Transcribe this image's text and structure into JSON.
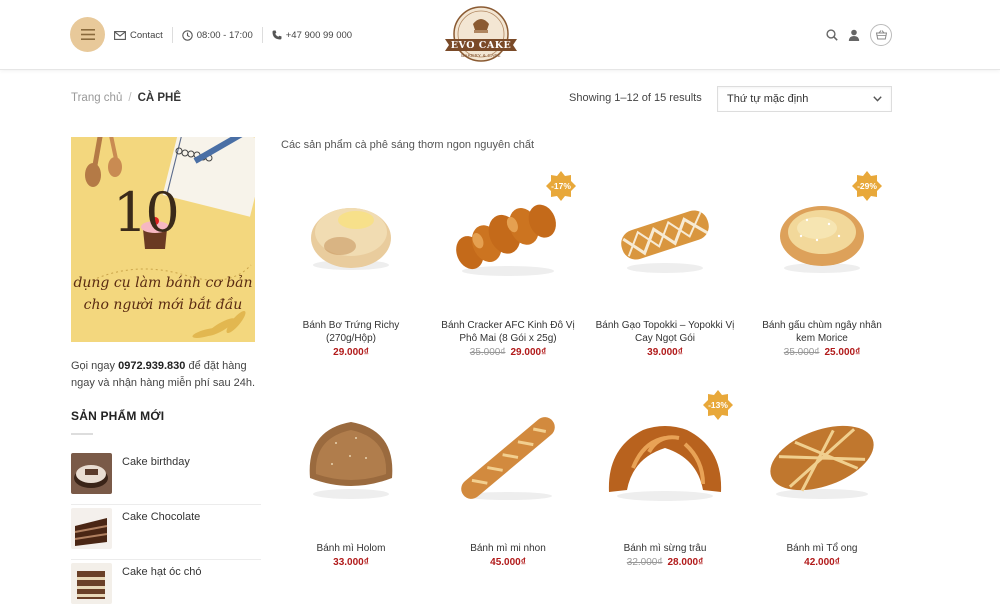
{
  "header": {
    "contact_label": "Contact",
    "hours": "08:00 - 17:00",
    "phone": "+47 900 99 000",
    "logo_text": "EVO CAKE",
    "logo_tagline": "BAKERY & CAFE"
  },
  "breadcrumb": {
    "home": "Trang chủ",
    "separator": "/",
    "current": "CÀ PHÊ"
  },
  "results_text": "Showing 1–12 of 15 results",
  "sort": {
    "selected": "Thứ tự mặc định"
  },
  "promo": {
    "number": "10",
    "line1": "dụng cụ làm bánh cơ bản",
    "line2": "cho người mới bắt đầu"
  },
  "sidebar": {
    "call_prefix": "Gọi ngay ",
    "call_phone": "0972.939.830",
    "call_suffix": " để đặt hàng ngay và nhận hàng miễn phí sau 24h.",
    "heading": "SẢN PHẨM MỚI",
    "items": [
      {
        "name": "Cake birthday"
      },
      {
        "name": "Cake Chocolate"
      },
      {
        "name": "Cake hạt óc chó"
      }
    ]
  },
  "intro": "Các sản phẩm cà phê sáng thơm ngon nguyên chất",
  "products": [
    {
      "title": "Bánh Bơ Trứng Richy (270g/Hộp)",
      "old_price": "",
      "price": "29.000₫",
      "badge": ""
    },
    {
      "title": "Bánh Cracker AFC Kinh Đô Vị Phô Mai (8 Gói x 25g)",
      "old_price": "35.000₫",
      "price": "29.000₫",
      "badge": "-17%"
    },
    {
      "title": "Bánh Gạo Topokki – Yopokki Vị Cay Ngọt Gói",
      "old_price": "",
      "price": "39.000₫",
      "badge": ""
    },
    {
      "title": "Bánh gấu chùm ngây nhân kem Morice",
      "old_price": "35.000₫",
      "price": "25.000₫",
      "badge": "-29%"
    },
    {
      "title": "Bánh mì Holom",
      "old_price": "",
      "price": "33.000₫",
      "badge": ""
    },
    {
      "title": "Bánh mì mi nhon",
      "old_price": "",
      "price": "45.000₫",
      "badge": ""
    },
    {
      "title": "Bánh mì sừng trâu",
      "old_price": "32.000₫",
      "price": "28.000₫",
      "badge": "-13%"
    },
    {
      "title": "Bánh mì Tổ ong",
      "old_price": "",
      "price": "42.000₫",
      "badge": ""
    }
  ],
  "colors": {
    "accent": "#e8c99a",
    "price": "#b11a1a",
    "badge": "#e8a83a"
  }
}
